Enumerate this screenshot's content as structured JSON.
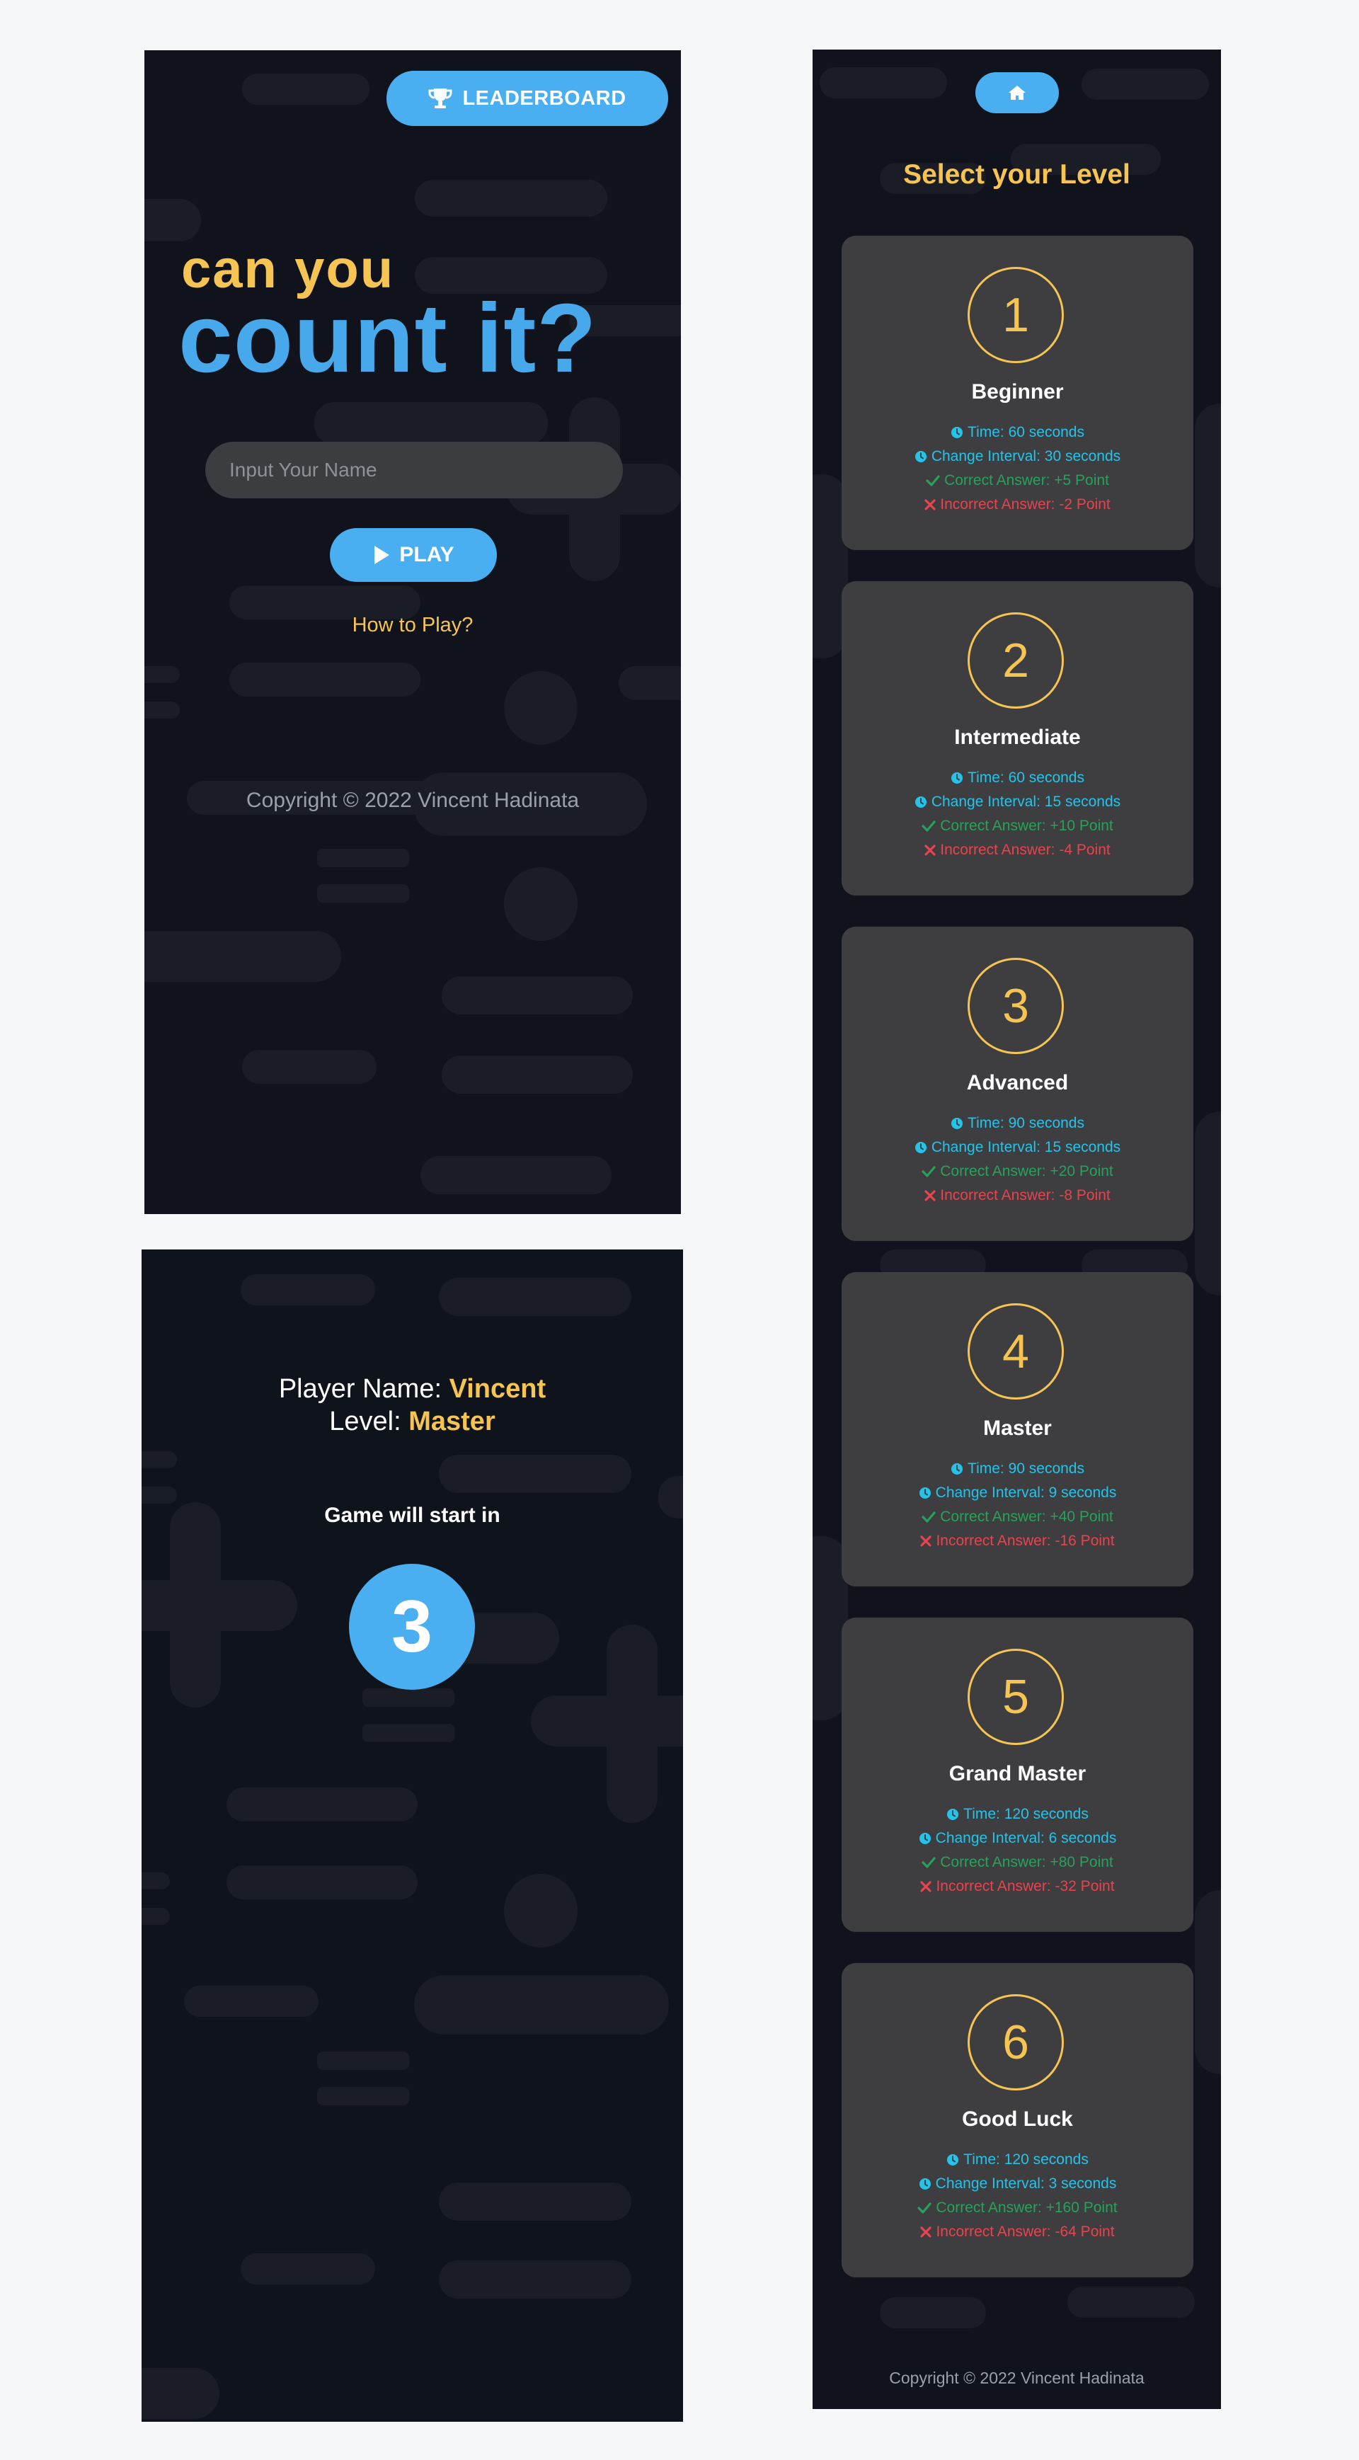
{
  "home": {
    "leaderboard_label": "LEADERBOARD",
    "logo_line1": "can you",
    "logo_line2": "count it?",
    "name_placeholder": "Input Your Name",
    "play_label": "PLAY",
    "how_to_play": "How to Play?",
    "copyright": "Copyright © 2022 Vincent Hadinata"
  },
  "countdown": {
    "player_label": "Player Name:",
    "player_name": "Vincent",
    "level_label": "Level:",
    "level_value": "Master",
    "start_text": "Game will start in",
    "count": "3"
  },
  "levels": {
    "title": "Select your Level",
    "copyright": "Copyright © 2022 Vincent Hadinata",
    "items": [
      {
        "number": "1",
        "name": "Beginner",
        "time": "Time: 60 seconds",
        "interval": "Change Interval: 30 seconds",
        "correct": "Correct Answer: +5 Point",
        "incorrect": "Incorrect Answer: -2 Point"
      },
      {
        "number": "2",
        "name": "Intermediate",
        "time": "Time: 60 seconds",
        "interval": "Change Interval: 15 seconds",
        "correct": "Correct Answer: +10 Point",
        "incorrect": "Incorrect Answer: -4 Point"
      },
      {
        "number": "3",
        "name": "Advanced",
        "time": "Time: 90 seconds",
        "interval": "Change Interval: 15 seconds",
        "correct": "Correct Answer: +20 Point",
        "incorrect": "Incorrect Answer: -8 Point"
      },
      {
        "number": "4",
        "name": "Master",
        "time": "Time: 90 seconds",
        "interval": "Change Interval: 9 seconds",
        "correct": "Correct Answer: +40 Point",
        "incorrect": "Incorrect Answer: -16 Point"
      },
      {
        "number": "5",
        "name": "Grand Master",
        "time": "Time: 120 seconds",
        "interval": "Change Interval: 6 seconds",
        "correct": "Correct Answer: +80 Point",
        "incorrect": "Incorrect Answer: -32 Point"
      },
      {
        "number": "6",
        "name": "Good Luck",
        "time": "Time: 120 seconds",
        "interval": "Change Interval: 3 seconds",
        "correct": "Correct Answer: +160 Point",
        "incorrect": "Incorrect Answer: -64 Point"
      }
    ]
  },
  "colors": {
    "accent_blue": "#4aaff1",
    "accent_yellow": "#f6c453",
    "panel_bg": "#10131c",
    "card_bg": "#3e3e40",
    "stat_cyan": "#24c3ea",
    "stat_green": "#25a35a",
    "stat_red": "#e9434d"
  },
  "icons": {
    "leaderboard": "trophy-icon",
    "play": "play-icon",
    "home": "home-icon",
    "time": "clock-icon",
    "interval": "clock-icon",
    "correct": "check-icon",
    "incorrect": "x-icon"
  }
}
